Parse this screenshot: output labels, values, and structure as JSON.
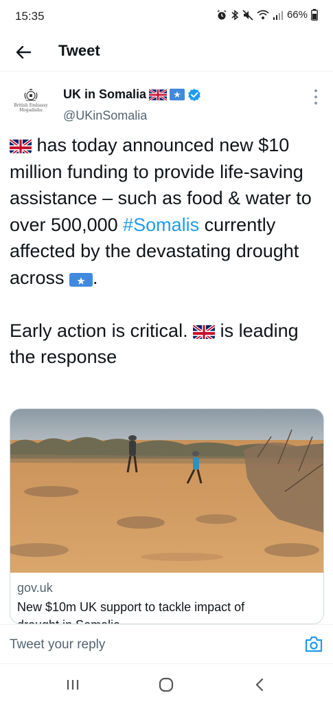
{
  "status_bar": {
    "time": "15:35",
    "battery": "66%",
    "icons": [
      "alarm-icon",
      "bluetooth-icon",
      "mute-icon",
      "wifi-icon",
      "signal-icon",
      "battery-icon"
    ]
  },
  "header": {
    "title": "Tweet",
    "back_icon": "back-arrow-icon"
  },
  "author": {
    "name": "UK in Somalia",
    "handle": "@UKinSomalia",
    "avatar_text_line1": "British Embassy",
    "avatar_text_line2": "Mogadishu",
    "verified": true
  },
  "tweet": {
    "para1_part1": " has today announced new $10 million funding to provide life-saving assistance – such as food &  water to over 500,000 ",
    "hashtag": "#Somalis",
    "para1_part2": " currently affected by the devastating drought across ",
    "para1_end": ".",
    "para2_part1": "Early action is critical. ",
    "para2_part2": " is leading the response"
  },
  "card": {
    "domain": "gov.uk",
    "title": "New $10m UK support to tackle impact of",
    "title_cut": "drought in Somalia"
  },
  "reply": {
    "placeholder": "Tweet your reply"
  },
  "colors": {
    "accent": "#1d9bf0",
    "text": "#0f1419",
    "secondary": "#536471"
  }
}
